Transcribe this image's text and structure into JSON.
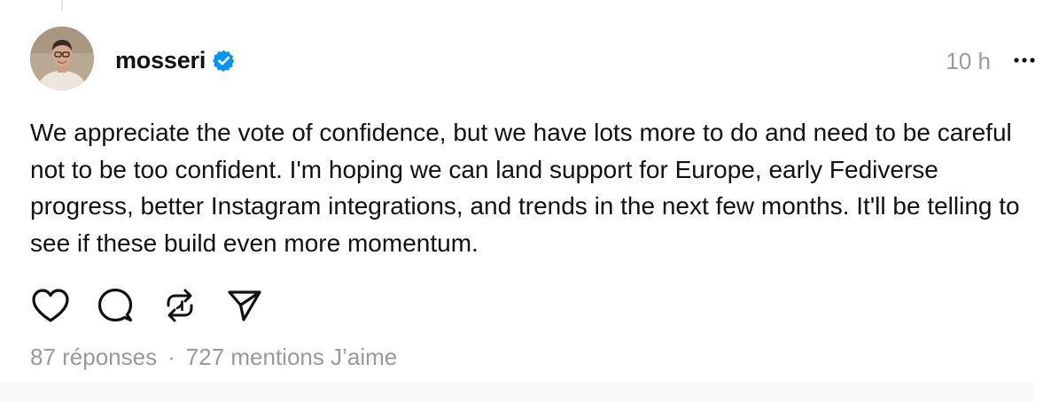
{
  "post": {
    "author": {
      "username": "mosseri",
      "verified": true,
      "avatar_icon": "profile-photo"
    },
    "timestamp": "10 h",
    "text": "We appreciate the vote of confidence, but we have lots more to do and need to be careful not to be too confident. I'm hoping we can land support for Europe, early Fediverse progress, better Instagram integrations, and trends in the next few months. It'll be telling to see if these build even more momentum.",
    "actions": [
      {
        "name": "like",
        "icon": "heart-icon"
      },
      {
        "name": "reply",
        "icon": "comment-icon"
      },
      {
        "name": "repost",
        "icon": "repost-icon"
      },
      {
        "name": "share",
        "icon": "send-icon"
      }
    ],
    "stats": {
      "replies": "87 réponses",
      "separator": "·",
      "likes": "727 mentions J’aime"
    }
  },
  "colors": {
    "text": "#111111",
    "muted": "#999999",
    "verified_blue": "#0095f6"
  }
}
